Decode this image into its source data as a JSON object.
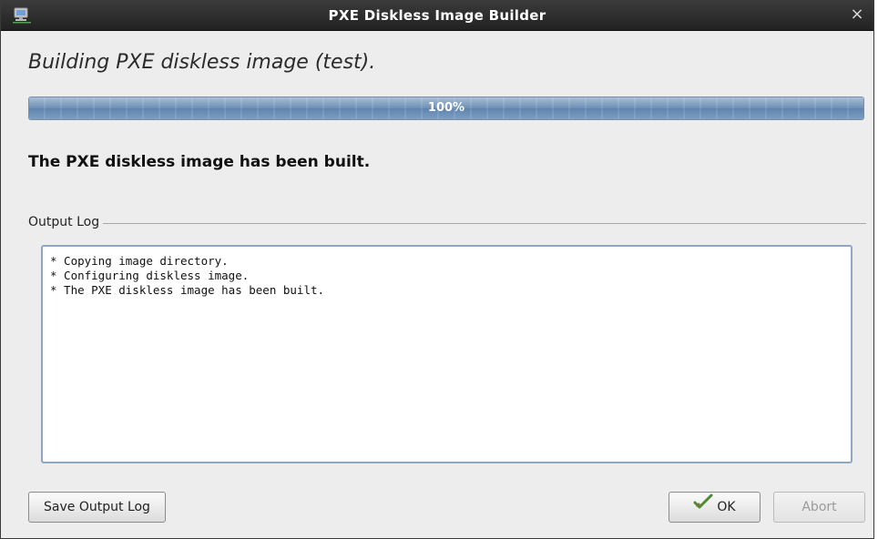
{
  "window": {
    "title": "PXE Diskless Image Builder",
    "icon": "network-computer-icon",
    "close_label": "×"
  },
  "main": {
    "heading": "Building PXE diskless image (test).",
    "progress": {
      "value": 1.0,
      "label": "100%"
    },
    "status_message": "The PXE diskless image has been built."
  },
  "output_log": {
    "group_label": "Output Log",
    "lines": [
      "* Copying image directory.",
      "* Configuring diskless image.",
      "* The PXE diskless image has been built."
    ]
  },
  "buttons": {
    "save_log": "Save Output Log",
    "ok": "OK",
    "ok_icon": "checkmark-pen-icon",
    "abort": "Abort"
  },
  "colors": {
    "titlebar": "#2a2a2a",
    "progress_fill": "#6d8fb5",
    "log_border": "#8fa6c4"
  }
}
